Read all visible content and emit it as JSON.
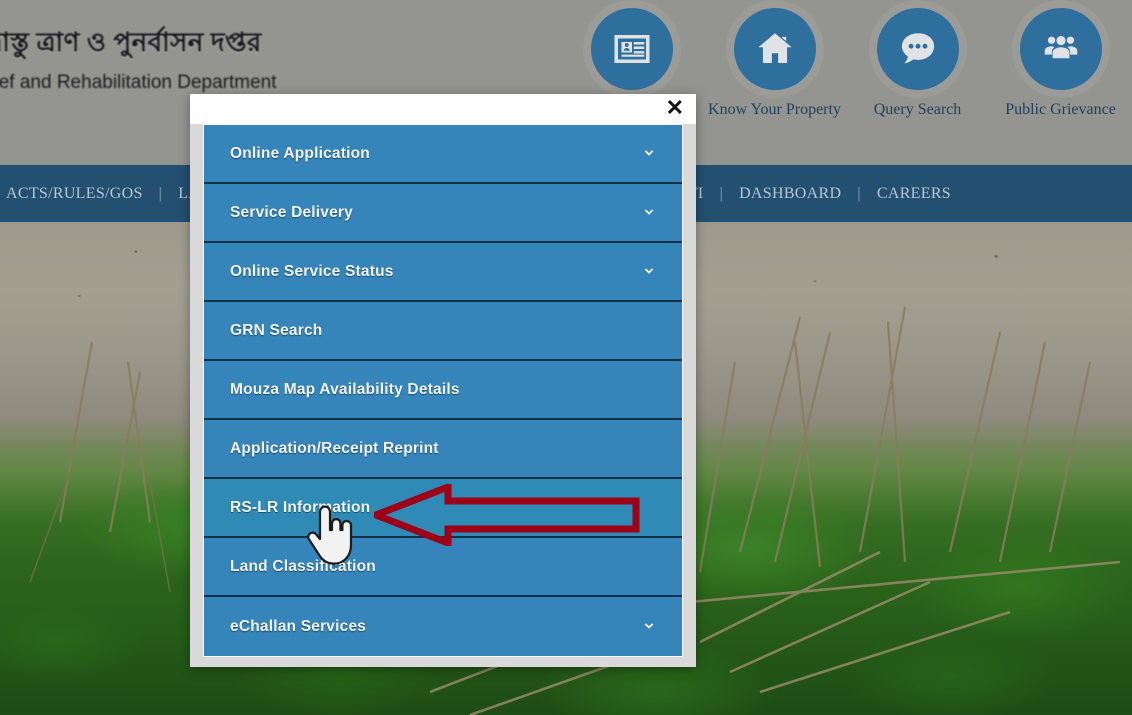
{
  "site": {
    "title_bn": "উদ্বাস্তু ত্রাণ ও পুনর্বাসন দপ্তর",
    "title_en": "Relief and Rehabilitation Department"
  },
  "header": {
    "icons": [
      {
        "icon": "id-card-icon",
        "label": ""
      },
      {
        "icon": "home-icon",
        "label": "Know Your Property"
      },
      {
        "icon": "chat-bubble-icon",
        "label": "Query Search"
      },
      {
        "icon": "people-group-icon",
        "label": "Public Grievance"
      }
    ]
  },
  "navbar": {
    "left_items": [
      "ACTS/RULES/GOS",
      "LA"
    ],
    "right_items": [
      "TI",
      "DASHBOARD",
      "CAREERS"
    ],
    "separator": "|"
  },
  "modal": {
    "close_label": "✕",
    "close_icon": "close-icon",
    "menu": [
      {
        "label": "Online Application",
        "has_chevron": true,
        "active": false
      },
      {
        "label": "Service Delivery",
        "has_chevron": true,
        "active": false
      },
      {
        "label": "Online Service Status",
        "has_chevron": true,
        "active": false
      },
      {
        "label": "GRN Search",
        "has_chevron": false,
        "active": false
      },
      {
        "label": "Mouza Map Availability Details",
        "has_chevron": false,
        "active": false
      },
      {
        "label": "Application/Receipt Reprint",
        "has_chevron": false,
        "active": false
      },
      {
        "label": "RS-LR Information",
        "has_chevron": false,
        "active": true
      },
      {
        "label": "Land Classification",
        "has_chevron": false,
        "active": false
      },
      {
        "label": "eChallan Services",
        "has_chevron": true,
        "active": false
      }
    ]
  },
  "annotations": {
    "arrow": {
      "name": "red-arrow-annotation",
      "color": "#9e0018",
      "direction": "left"
    },
    "cursor": {
      "name": "hand-cursor",
      "type": "pointer-hand"
    }
  },
  "colors": {
    "header_bg": "#949491",
    "navbar_bg": "#235070",
    "menu_item_bg": "#3585bb",
    "menu_item_active_bg": "#2f8ab5",
    "modal_bg": "#d9d9d9",
    "icon_circle": "#2e6f9e",
    "annotation_red": "#9e0018"
  }
}
